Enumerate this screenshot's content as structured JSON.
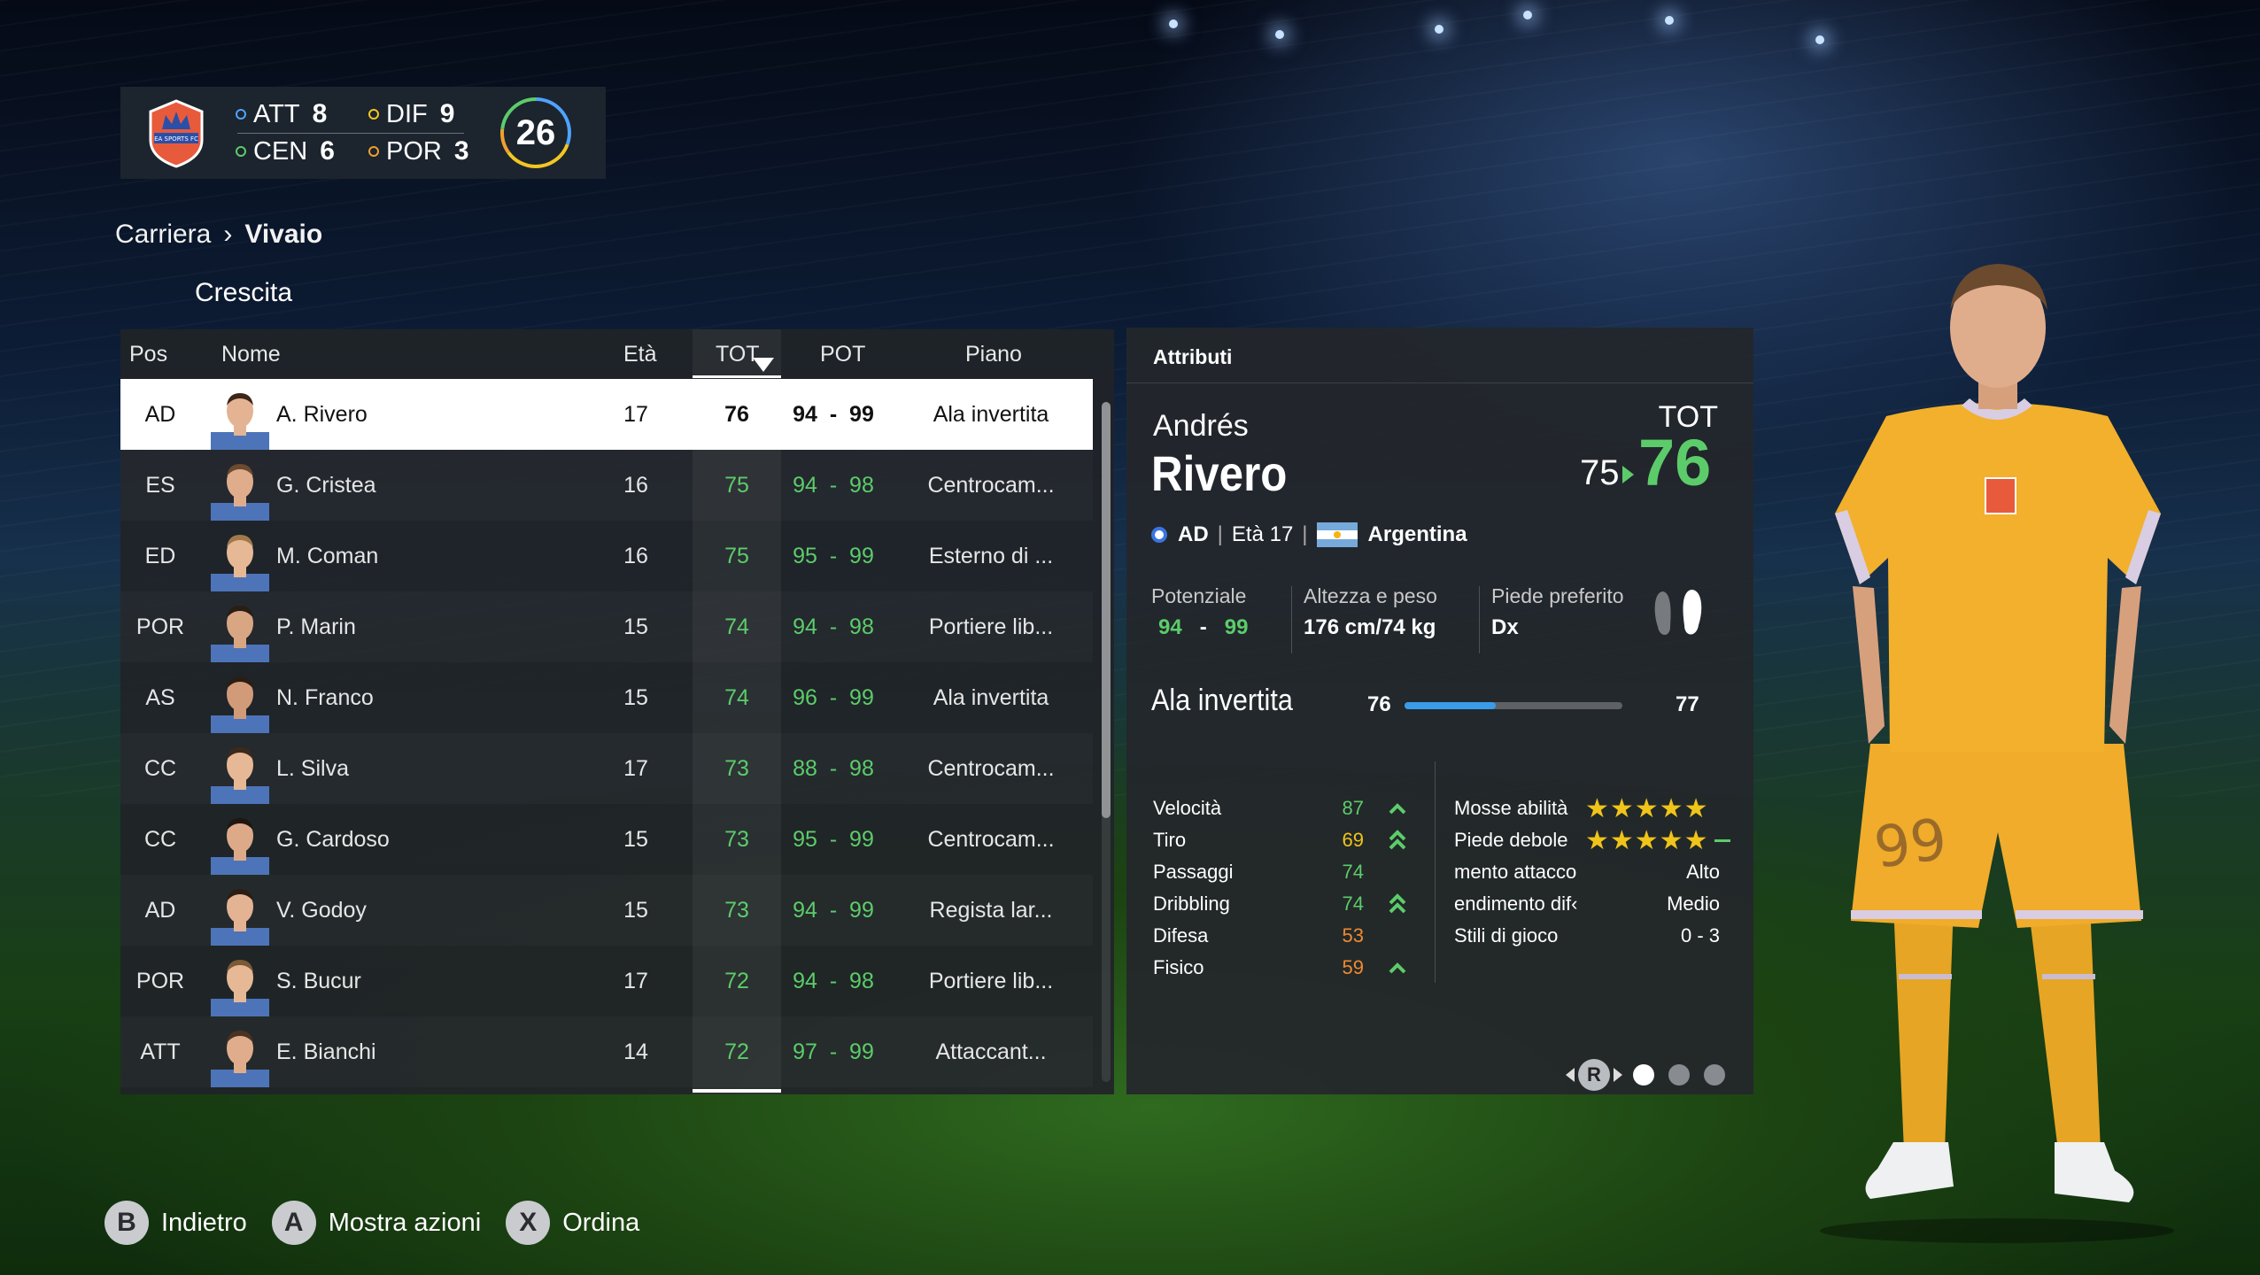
{
  "summary": {
    "club_badge_text": "EA SPORTS FC",
    "positions": [
      {
        "code": "ATT",
        "count": "8",
        "color": "#4fa3ff"
      },
      {
        "code": "DIF",
        "count": "9",
        "color": "#f3c623"
      },
      {
        "code": "CEN",
        "count": "6",
        "color": "#5ccc6a"
      },
      {
        "code": "POR",
        "count": "3",
        "color": "#f0a030"
      }
    ],
    "total": "26"
  },
  "breadcrumb": {
    "parent": "Carriera",
    "current": "Vivaio"
  },
  "subtitle": "Crescita",
  "table": {
    "headers": {
      "pos": "Pos",
      "name": "Nome",
      "age": "Età",
      "tot": "TOT",
      "pot": "POT",
      "plan": "Piano"
    },
    "rows": [
      {
        "pos": "AD",
        "name": "A. Rivero",
        "age": "17",
        "tot": "76",
        "pot": "94  -  99",
        "plan": "Ala invertita",
        "skin": "#e3b394",
        "hair": "#3b2618"
      },
      {
        "pos": "ES",
        "name": "G. Cristea",
        "age": "16",
        "tot": "75",
        "pot": "94  -  98",
        "plan": "Centrocam...",
        "skin": "#e0ad8c",
        "hair": "#6b4a2e"
      },
      {
        "pos": "ED",
        "name": "M. Coman",
        "age": "16",
        "tot": "75",
        "pot": "95  -  99",
        "plan": "Esterno di ...",
        "skin": "#e6b896",
        "hair": "#a07a4a"
      },
      {
        "pos": "POR",
        "name": "P. Marin",
        "age": "15",
        "tot": "74",
        "pot": "94  -  98",
        "plan": "Portiere lib...",
        "skin": "#d9a684",
        "hair": "#2a1d14"
      },
      {
        "pos": "AS",
        "name": "N. Franco",
        "age": "15",
        "tot": "74",
        "pot": "96  -  99",
        "plan": "Ala invertita",
        "skin": "#d19a78",
        "hair": "#2a1d14"
      },
      {
        "pos": "CC",
        "name": "L. Silva",
        "age": "17",
        "tot": "73",
        "pot": "88  -  98",
        "plan": "Centrocam...",
        "skin": "#e6b896",
        "hair": "#3b2a1c"
      },
      {
        "pos": "CC",
        "name": "G. Cardoso",
        "age": "15",
        "tot": "73",
        "pot": "95  -  99",
        "plan": "Centrocam...",
        "skin": "#dcaa88",
        "hair": "#1f1611"
      },
      {
        "pos": "AD",
        "name": "V. Godoy",
        "age": "15",
        "tot": "73",
        "pot": "94  -  99",
        "plan": "Regista lar...",
        "skin": "#e3b394",
        "hair": "#2a1d14"
      },
      {
        "pos": "POR",
        "name": "S. Bucur",
        "age": "17",
        "tot": "72",
        "pot": "94  -  98",
        "plan": "Portiere lib...",
        "skin": "#e6b896",
        "hair": "#7a5a36"
      },
      {
        "pos": "ATT",
        "name": "E. Bianchi",
        "age": "14",
        "tot": "72",
        "pot": "97  -  99",
        "plan": "Attaccant...",
        "skin": "#e0ad8c",
        "hair": "#4a3322"
      }
    ],
    "selected_index": 0
  },
  "attributes": {
    "title": "Attributi",
    "first_name": "Andrés",
    "last_name": "Rivero",
    "tot_label": "TOT",
    "tot_old": "75",
    "tot_new": "76",
    "position": "AD",
    "age_text": "Età 17",
    "nation": "Argentina",
    "potential_label": "Potenziale",
    "potential_min": "94",
    "potential_dash": "-",
    "potential_max": "99",
    "height_weight_label": "Altezza e peso",
    "height_weight": "176 cm/74 kg",
    "foot_label": "Piede preferito",
    "foot": "Dx",
    "role": "Ala invertita",
    "role_min": "76",
    "role_max": "77",
    "role_progress": 0.42,
    "stats": [
      {
        "name": "Velocità",
        "value": "87",
        "color": "#5ccc6a",
        "trend": "up"
      },
      {
        "name": "Tiro",
        "value": "69",
        "color": "#f0c419",
        "trend": "up-double"
      },
      {
        "name": "Passaggi",
        "value": "74",
        "color": "#5ccc6a",
        "trend": "none"
      },
      {
        "name": "Dribbling",
        "value": "74",
        "color": "#5ccc6a",
        "trend": "up-double"
      },
      {
        "name": "Difesa",
        "value": "53",
        "color": "#f08a30",
        "trend": "none"
      },
      {
        "name": "Fisico",
        "value": "59",
        "color": "#f08a30",
        "trend": "up"
      }
    ],
    "traits": [
      {
        "name": "Mosse abilità",
        "stars": "★★★★★"
      },
      {
        "name": "Piede debole",
        "stars": "★★★★★"
      },
      {
        "name": "mento attacco",
        "value": "Alto"
      },
      {
        "name": "endimento dif‹",
        "value": "Medio"
      },
      {
        "name": "Stili di gioco",
        "value": "0 - 3"
      }
    ],
    "pager_button": "R"
  },
  "jersey_number": "99",
  "footer": [
    {
      "glyph": "B",
      "label": "Indietro"
    },
    {
      "glyph": "A",
      "label": "Mostra azioni"
    },
    {
      "glyph": "X",
      "label": "Ordina"
    }
  ]
}
